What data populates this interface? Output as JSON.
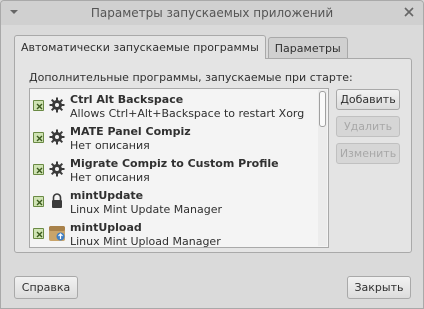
{
  "window": {
    "title": "Параметры запускаемых приложений"
  },
  "tabs": [
    {
      "label": "Автоматически запускаемые программы",
      "active": true
    },
    {
      "label": "Параметры",
      "active": false
    }
  ],
  "panel": {
    "label": "Дополнительные программы, запускаемые при старте:"
  },
  "startup_items": [
    {
      "name": "Ctrl Alt Backspace",
      "description": "Allows Ctrl+Alt+Backspace to restart Xorg",
      "enabled": true,
      "icon": "gear-icon"
    },
    {
      "name": "MATE Panel Compiz",
      "description": "Нет описания",
      "enabled": true,
      "icon": "gear-icon"
    },
    {
      "name": "Migrate Compiz to Custom Profile",
      "description": "Нет описания",
      "enabled": true,
      "icon": "gear-icon"
    },
    {
      "name": "mintUpdate",
      "description": "Linux Mint Update Manager",
      "enabled": true,
      "icon": "lock-icon"
    },
    {
      "name": "mintUpload",
      "description": "Linux Mint Upload Manager",
      "enabled": true,
      "icon": "upload-icon"
    }
  ],
  "buttons": {
    "add": "Добавить",
    "remove": "Удалить",
    "edit": "Изменить",
    "help": "Справка",
    "close": "Закрыть"
  },
  "colors": {
    "window_bg": "#d6d6d6",
    "panel_bg": "#e4e4e4",
    "list_bg": "#f4f4f4",
    "check_green": "#6a8a44"
  }
}
